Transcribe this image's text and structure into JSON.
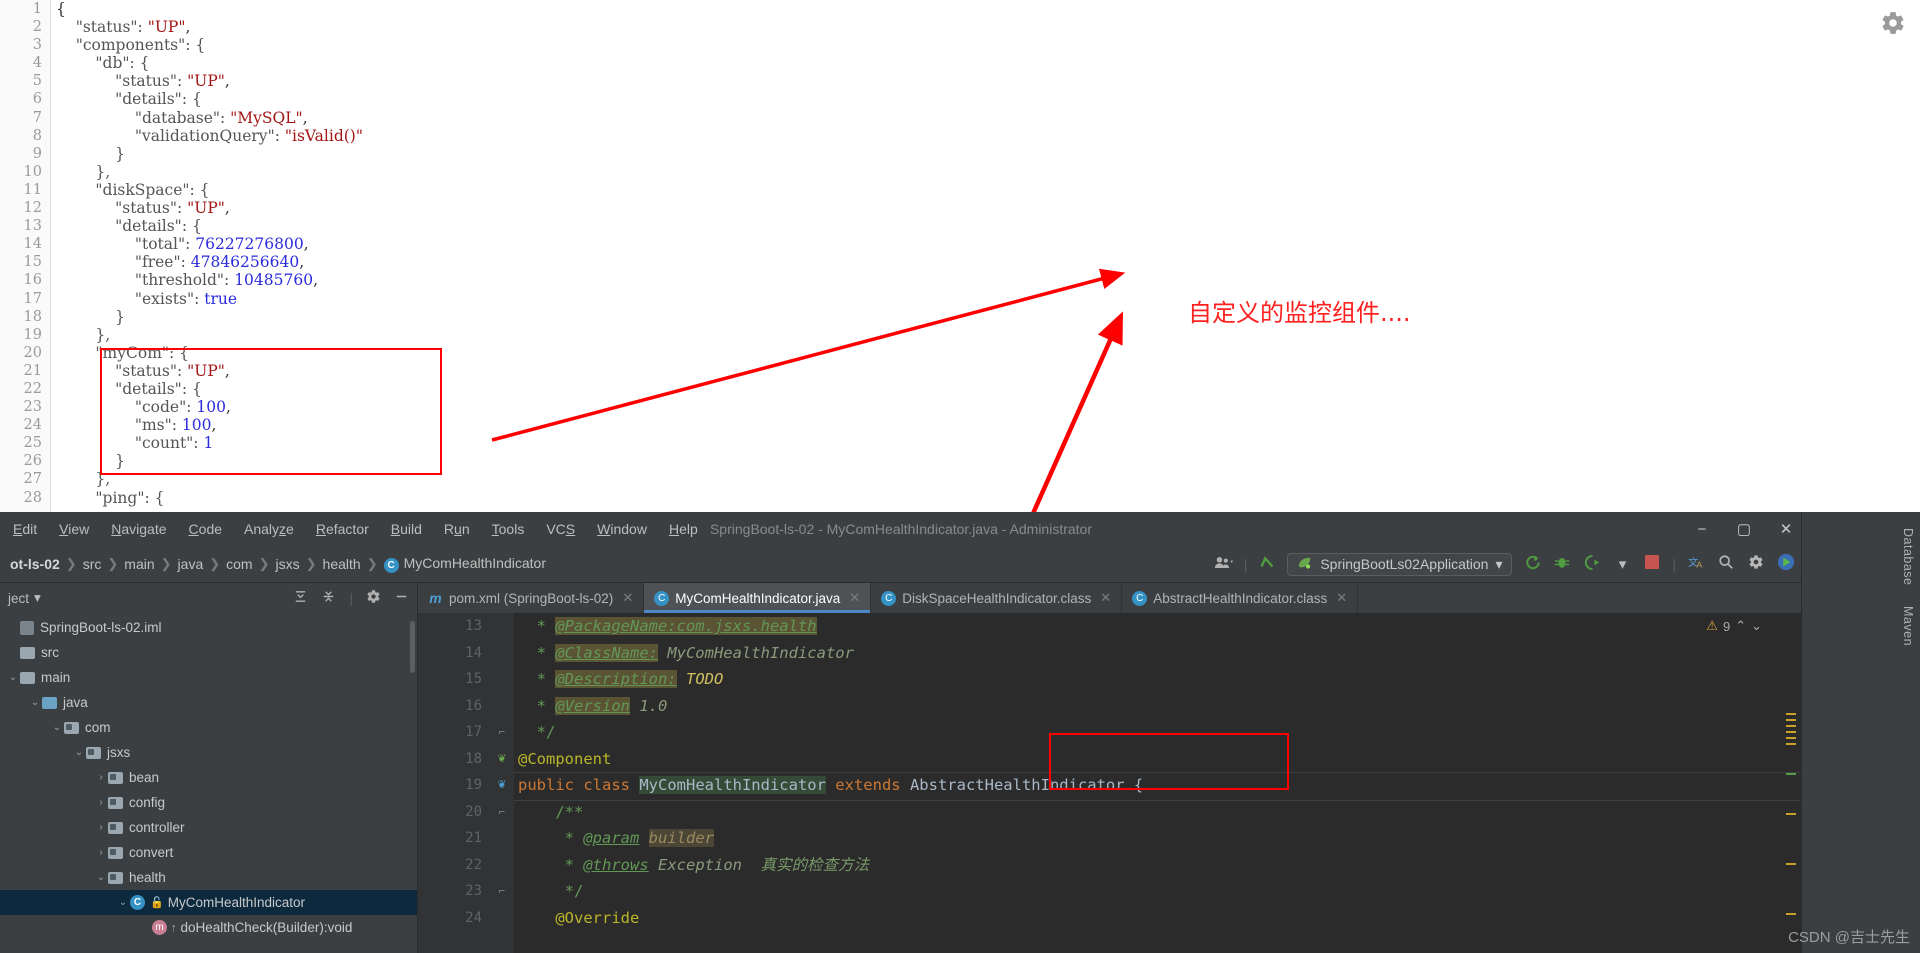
{
  "browser": {
    "gear_icon": "gear-icon",
    "json_lines": [
      {
        "n": 1,
        "segs": [
          {
            "t": "{",
            "c": "jp"
          }
        ]
      },
      {
        "n": 2,
        "segs": [
          {
            "t": "    \"status\": ",
            "c": "jk"
          },
          {
            "t": "\"UP\"",
            "c": "js"
          },
          {
            "t": ",",
            "c": "jp"
          }
        ]
      },
      {
        "n": 3,
        "segs": [
          {
            "t": "    \"components\": {",
            "c": "jk"
          }
        ]
      },
      {
        "n": 4,
        "segs": [
          {
            "t": "        \"db\": {",
            "c": "jk"
          }
        ]
      },
      {
        "n": 5,
        "segs": [
          {
            "t": "            \"status\": ",
            "c": "jk"
          },
          {
            "t": "\"UP\"",
            "c": "js"
          },
          {
            "t": ",",
            "c": "jp"
          }
        ]
      },
      {
        "n": 6,
        "segs": [
          {
            "t": "            \"details\": {",
            "c": "jk"
          }
        ]
      },
      {
        "n": 7,
        "segs": [
          {
            "t": "                \"database\": ",
            "c": "jk"
          },
          {
            "t": "\"MySQL\"",
            "c": "js"
          },
          {
            "t": ",",
            "c": "jp"
          }
        ]
      },
      {
        "n": 8,
        "segs": [
          {
            "t": "                \"validationQuery\": ",
            "c": "jk"
          },
          {
            "t": "\"isValid()\"",
            "c": "js"
          }
        ]
      },
      {
        "n": 9,
        "segs": [
          {
            "t": "            }",
            "c": "jk"
          }
        ]
      },
      {
        "n": 10,
        "segs": [
          {
            "t": "        },",
            "c": "jk"
          }
        ]
      },
      {
        "n": 11,
        "segs": [
          {
            "t": "        \"diskSpace\": {",
            "c": "jk"
          }
        ]
      },
      {
        "n": 12,
        "segs": [
          {
            "t": "            \"status\": ",
            "c": "jk"
          },
          {
            "t": "\"UP\"",
            "c": "js"
          },
          {
            "t": ",",
            "c": "jp"
          }
        ]
      },
      {
        "n": 13,
        "segs": [
          {
            "t": "            \"details\": {",
            "c": "jk"
          }
        ]
      },
      {
        "n": 14,
        "segs": [
          {
            "t": "                \"total\": ",
            "c": "jk"
          },
          {
            "t": "76227276800",
            "c": "jn"
          },
          {
            "t": ",",
            "c": "jp"
          }
        ]
      },
      {
        "n": 15,
        "segs": [
          {
            "t": "                \"free\": ",
            "c": "jk"
          },
          {
            "t": "47846256640",
            "c": "jn"
          },
          {
            "t": ",",
            "c": "jp"
          }
        ]
      },
      {
        "n": 16,
        "segs": [
          {
            "t": "                \"threshold\": ",
            "c": "jk"
          },
          {
            "t": "10485760",
            "c": "jn"
          },
          {
            "t": ",",
            "c": "jp"
          }
        ]
      },
      {
        "n": 17,
        "segs": [
          {
            "t": "                \"exists\": ",
            "c": "jk"
          },
          {
            "t": "true",
            "c": "jb"
          }
        ]
      },
      {
        "n": 18,
        "segs": [
          {
            "t": "            }",
            "c": "jk"
          }
        ]
      },
      {
        "n": 19,
        "segs": [
          {
            "t": "        },",
            "c": "jk"
          }
        ]
      },
      {
        "n": 20,
        "segs": [
          {
            "t": "        \"myCom\": {",
            "c": "jk"
          }
        ]
      },
      {
        "n": 21,
        "segs": [
          {
            "t": "            \"status\": ",
            "c": "jk"
          },
          {
            "t": "\"UP\"",
            "c": "js"
          },
          {
            "t": ",",
            "c": "jp"
          }
        ]
      },
      {
        "n": 22,
        "segs": [
          {
            "t": "            \"details\": {",
            "c": "jk"
          }
        ]
      },
      {
        "n": 23,
        "segs": [
          {
            "t": "                \"code\": ",
            "c": "jk"
          },
          {
            "t": "100",
            "c": "jn"
          },
          {
            "t": ",",
            "c": "jp"
          }
        ]
      },
      {
        "n": 24,
        "segs": [
          {
            "t": "                \"ms\": ",
            "c": "jk"
          },
          {
            "t": "100",
            "c": "jn"
          },
          {
            "t": ",",
            "c": "jp"
          }
        ]
      },
      {
        "n": 25,
        "segs": [
          {
            "t": "                \"count\": ",
            "c": "jk"
          },
          {
            "t": "1",
            "c": "jn"
          }
        ]
      },
      {
        "n": 26,
        "segs": [
          {
            "t": "            }",
            "c": "jk"
          }
        ]
      },
      {
        "n": 27,
        "segs": [
          {
            "t": "        },",
            "c": "jk"
          }
        ]
      },
      {
        "n": 28,
        "segs": [
          {
            "t": "        \"ping\": {",
            "c": "jk"
          }
        ]
      }
    ],
    "annotation": "自定义的监控组件....",
    "annotation_color": "#ff2020",
    "highlight_color": "#ff0000"
  },
  "ide": {
    "window_title": "SpringBoot-ls-02 - MyComHealthIndicator.java - Administrator",
    "menu": [
      {
        "label": "Edit",
        "mn": "E"
      },
      {
        "label": "View",
        "mn": "V"
      },
      {
        "label": "Navigate",
        "mn": "N"
      },
      {
        "label": "Code",
        "mn": "C"
      },
      {
        "label": "Analyze",
        "mn": "z"
      },
      {
        "label": "Refactor",
        "mn": "R"
      },
      {
        "label": "Build",
        "mn": "B"
      },
      {
        "label": "Run",
        "mn": "u"
      },
      {
        "label": "Tools",
        "mn": "T"
      },
      {
        "label": "VCS",
        "mn": "S"
      },
      {
        "label": "Window",
        "mn": "W"
      },
      {
        "label": "Help",
        "mn": "H"
      }
    ],
    "window_controls": {
      "minimize": "−",
      "maximize": "▢",
      "close": "✕"
    },
    "breadcrumb": [
      {
        "label": "ot-ls-02",
        "icon": ""
      },
      {
        "label": "src",
        "icon": ""
      },
      {
        "label": "main",
        "icon": ""
      },
      {
        "label": "java",
        "icon": ""
      },
      {
        "label": "com",
        "icon": ""
      },
      {
        "label": "jsxs",
        "icon": ""
      },
      {
        "label": "health",
        "icon": ""
      },
      {
        "label": "MyComHealthIndicator",
        "icon": "class-badge"
      }
    ],
    "breadcrumb_separator": "❯",
    "toolbar": {
      "user_icon": "user-dropdown-icon",
      "hammer_icon": "build-hammer-icon",
      "run_config_label": "SpringBootLs02Application",
      "run_config_icon": "spring-leaf-icon",
      "dropdown_caret": "▾",
      "run_icon": "run-icon",
      "debug_icon": "debug-bug-icon",
      "run_coverage_icon": "run-with-coverage-icon",
      "more_caret": "▾",
      "stop_icon": "stop-icon",
      "translate_icon": "translate-icon",
      "search_icon": "search-icon",
      "settings_icon": "settings-gear-icon",
      "update_icon": "ide-update-icon"
    },
    "project_pane": {
      "title": "ject",
      "caret": "▾",
      "expand_all_icon": "expand-all-icon",
      "collapse_all_icon": "collapse-all-icon",
      "settings_icon": "project-settings-gear-icon",
      "hide_icon": "hide-panel-icon",
      "tree": [
        {
          "label": "SpringBoot-ls-02.iml",
          "indent": 0,
          "twist": "",
          "icon": "module-file",
          "selected": false
        },
        {
          "label": "src",
          "indent": 0,
          "twist": "",
          "icon": "folder",
          "selected": false
        },
        {
          "label": "main",
          "indent": 0,
          "twist": "⌄",
          "icon": "folder",
          "selected": false
        },
        {
          "label": "java",
          "indent": 1,
          "twist": "⌄",
          "icon": "folder-java",
          "selected": false
        },
        {
          "label": "com",
          "indent": 2,
          "twist": "⌄",
          "icon": "folder-pkg",
          "selected": false
        },
        {
          "label": "jsxs",
          "indent": 3,
          "twist": "⌄",
          "icon": "folder-pkg",
          "selected": false
        },
        {
          "label": "bean",
          "indent": 4,
          "twist": "›",
          "icon": "folder-pkg",
          "selected": false
        },
        {
          "label": "config",
          "indent": 4,
          "twist": "›",
          "icon": "folder-pkg",
          "selected": false
        },
        {
          "label": "controller",
          "indent": 4,
          "twist": "›",
          "icon": "folder-pkg",
          "selected": false
        },
        {
          "label": "convert",
          "indent": 4,
          "twist": "›",
          "icon": "folder-pkg",
          "selected": false
        },
        {
          "label": "health",
          "indent": 4,
          "twist": "⌄",
          "icon": "folder-pkg",
          "selected": false
        },
        {
          "label": "MyComHealthIndicator",
          "indent": 5,
          "twist": "⌄",
          "icon": "class",
          "selected": true
        },
        {
          "label": "doHealthCheck(Builder):void",
          "indent": 6,
          "twist": "",
          "icon": "method",
          "selected": false
        }
      ]
    },
    "tabs": [
      {
        "label": "pom.xml (SpringBoot-ls-02)",
        "icon": "maven-icon",
        "active": false,
        "close": "✕"
      },
      {
        "label": "MyComHealthIndicator.java",
        "icon": "class-icon",
        "active": true,
        "close": "✕"
      },
      {
        "label": "DiskSpaceHealthIndicator.class",
        "icon": "class-locked-icon",
        "active": false,
        "close": "✕"
      },
      {
        "label": "AbstractHealthIndicator.class",
        "icon": "abstract-class-locked-icon",
        "active": false,
        "close": "✕"
      }
    ],
    "editor": {
      "warning_count": "9",
      "warning_icon": "warning-triangle-icon",
      "up_arrow": "⌃",
      "down_arrow": "⌄",
      "highlight_color": "#ff0000",
      "lines": [
        {
          "n": 13,
          "gutter": "",
          "segs": [
            {
              "t": "  * ",
              "c": "c-com"
            },
            {
              "t": "@PackageName:com.jsxs.health",
              "c": "c-tag c-hl"
            }
          ]
        },
        {
          "n": 14,
          "gutter": "",
          "segs": [
            {
              "t": "  * ",
              "c": "c-com"
            },
            {
              "t": "@ClassName:",
              "c": "c-tag c-hl"
            },
            {
              "t": " MyComHealthIndicator",
              "c": "c-ital"
            }
          ]
        },
        {
          "n": 15,
          "gutter": "",
          "segs": [
            {
              "t": "  * ",
              "c": "c-com"
            },
            {
              "t": "@Description:",
              "c": "c-tag c-hl"
            },
            {
              "t": " ",
              "c": "c-com"
            },
            {
              "t": "TODO",
              "c": "c-todo"
            }
          ]
        },
        {
          "n": 16,
          "gutter": "",
          "segs": [
            {
              "t": "  * ",
              "c": "c-com"
            },
            {
              "t": "@Version",
              "c": "c-tag c-hl"
            },
            {
              "t": " 1.0",
              "c": "c-ital"
            }
          ]
        },
        {
          "n": 17,
          "gutter": "fold",
          "segs": [
            {
              "t": "  */",
              "c": "c-com"
            }
          ]
        },
        {
          "n": 18,
          "gutter": "spring",
          "segs": [
            {
              "t": "@Component",
              "c": "c-ann"
            }
          ]
        },
        {
          "n": 19,
          "gutter": "bean",
          "segs": [
            {
              "t": "public class ",
              "c": "c-kw"
            },
            {
              "t": "MyComHealthIndicator",
              "c": "c-cls c-sel"
            },
            {
              "t": " extends ",
              "c": "c-kw"
            },
            {
              "t": "AbstractHealthIndicator {",
              "c": "c-cls"
            }
          ]
        },
        {
          "n": 20,
          "gutter": "fold",
          "segs": [
            {
              "t": "    /**",
              "c": "c-com"
            }
          ]
        },
        {
          "n": 21,
          "gutter": "",
          "segs": [
            {
              "t": "     * ",
              "c": "c-com"
            },
            {
              "t": "@param",
              "c": "c-tag"
            },
            {
              "t": " ",
              "c": "c-com"
            },
            {
              "t": "builder",
              "c": "c-param"
            }
          ]
        },
        {
          "n": 22,
          "gutter": "",
          "segs": [
            {
              "t": "     * ",
              "c": "c-com"
            },
            {
              "t": "@throws",
              "c": "c-tag"
            },
            {
              "t": " ",
              "c": "c-com"
            },
            {
              "t": "Exception",
              "c": "c-ital"
            },
            {
              "t": "  真实的检查方法",
              "c": "c-cn"
            }
          ]
        },
        {
          "n": 23,
          "gutter": "fold",
          "segs": [
            {
              "t": "     */",
              "c": "c-com"
            }
          ]
        },
        {
          "n": 24,
          "gutter": "",
          "segs": [
            {
              "t": "    @Override",
              "c": "c-ann"
            }
          ]
        }
      ]
    },
    "right_tools": [
      {
        "label": "Database"
      },
      {
        "label": "Maven"
      }
    ]
  },
  "watermark": {
    "text": "CSDN @吉士先生",
    "logo": "CSDN"
  }
}
